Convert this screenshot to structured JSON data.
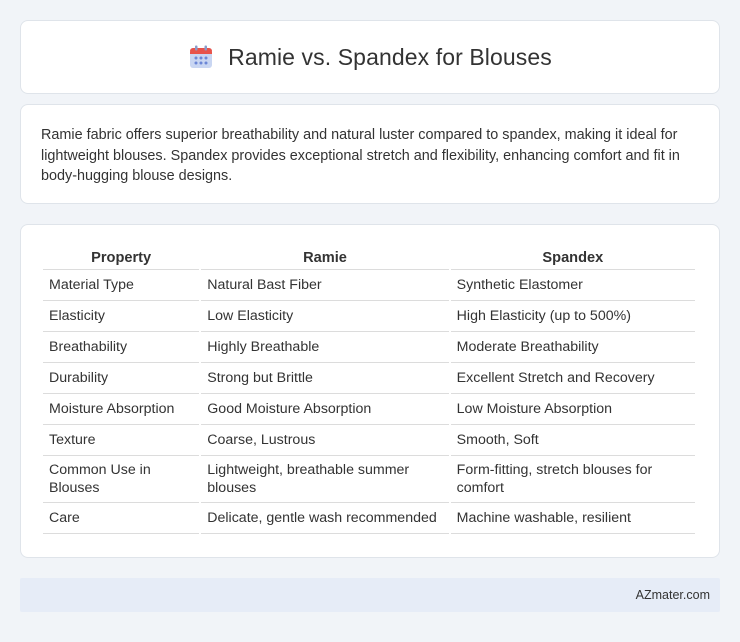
{
  "header": {
    "title": "Ramie vs. Spandex for Blouses",
    "icon": "calendar-icon",
    "icon_colors": {
      "top": "#e8534a",
      "body": "#c9d6f2",
      "dots": "#6b86d6"
    }
  },
  "summary": {
    "text": "Ramie fabric offers superior breathability and natural luster compared to spandex, making it ideal for lightweight blouses. Spandex provides exceptional stretch and flexibility, enhancing comfort and fit in body-hugging blouse designs."
  },
  "table": {
    "headers": [
      "Property",
      "Ramie",
      "Spandex"
    ],
    "rows": [
      [
        "Material Type",
        "Natural Bast Fiber",
        "Synthetic Elastomer"
      ],
      [
        "Elasticity",
        "Low Elasticity",
        "High Elasticity (up to 500%)"
      ],
      [
        "Breathability",
        "Highly Breathable",
        "Moderate Breathability"
      ],
      [
        "Durability",
        "Strong but Brittle",
        "Excellent Stretch and Recovery"
      ],
      [
        "Moisture Absorption",
        "Good Moisture Absorption",
        "Low Moisture Absorption"
      ],
      [
        "Texture",
        "Coarse, Lustrous",
        "Smooth, Soft"
      ],
      [
        "Common Use in Blouses",
        "Lightweight, breathable summer blouses",
        "Form-fitting, stretch blouses for comfort"
      ],
      [
        "Care",
        "Delicate, gentle wash recommended",
        "Machine washable, resilient"
      ]
    ]
  },
  "footer": {
    "text": "AZmater.com"
  }
}
